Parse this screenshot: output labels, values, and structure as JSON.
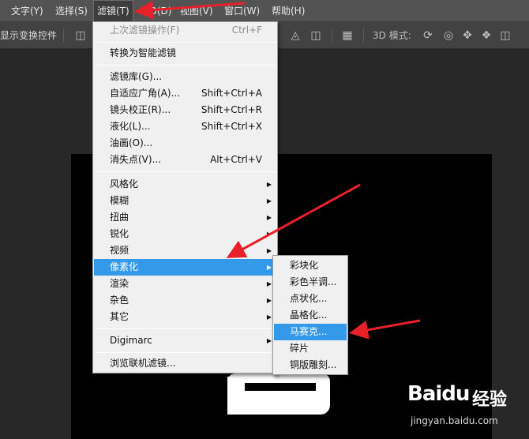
{
  "menubar": {
    "items": [
      {
        "label": "文字(Y)"
      },
      {
        "label": "选择(S)"
      },
      {
        "label": "滤镜(T)"
      },
      {
        "label": "3D(D)"
      },
      {
        "label": "视图(V)"
      },
      {
        "label": "窗口(W)"
      },
      {
        "label": "帮助(H)"
      }
    ]
  },
  "optbar": {
    "show_transform": "显示变换控件",
    "mode_3d": "3D 模式:"
  },
  "filter_menu": {
    "items": [
      {
        "label": "上次滤镜操作(F)",
        "shortcut": "Ctrl+F"
      },
      {
        "label": "转换为智能滤镜"
      },
      {
        "label": "滤镜库(G)..."
      },
      {
        "label": "自适应广角(A)...",
        "shortcut": "Shift+Ctrl+A"
      },
      {
        "label": "镜头校正(R)...",
        "shortcut": "Shift+Ctrl+R"
      },
      {
        "label": "液化(L)...",
        "shortcut": "Shift+Ctrl+X"
      },
      {
        "label": "油画(O)..."
      },
      {
        "label": "消失点(V)...",
        "shortcut": "Alt+Ctrl+V"
      },
      {
        "label": "风格化"
      },
      {
        "label": "模糊"
      },
      {
        "label": "扭曲"
      },
      {
        "label": "锐化"
      },
      {
        "label": "视频"
      },
      {
        "label": "像素化"
      },
      {
        "label": "渲染"
      },
      {
        "label": "杂色"
      },
      {
        "label": "其它"
      },
      {
        "label": "Digimarc"
      },
      {
        "label": "浏览联机滤镜..."
      }
    ]
  },
  "pixelate_menu": {
    "items": [
      {
        "label": "彩块化"
      },
      {
        "label": "彩色半调..."
      },
      {
        "label": "点状化..."
      },
      {
        "label": "晶格化..."
      },
      {
        "label": "马赛克..."
      },
      {
        "label": "碎片"
      },
      {
        "label": "铜版雕刻..."
      }
    ]
  },
  "watermark": {
    "brand": "Baidu",
    "cn": "经验",
    "url": "jingyan.baidu.com"
  },
  "colors": {
    "highlight": "#3399e8",
    "arrow": "#e8202a"
  }
}
